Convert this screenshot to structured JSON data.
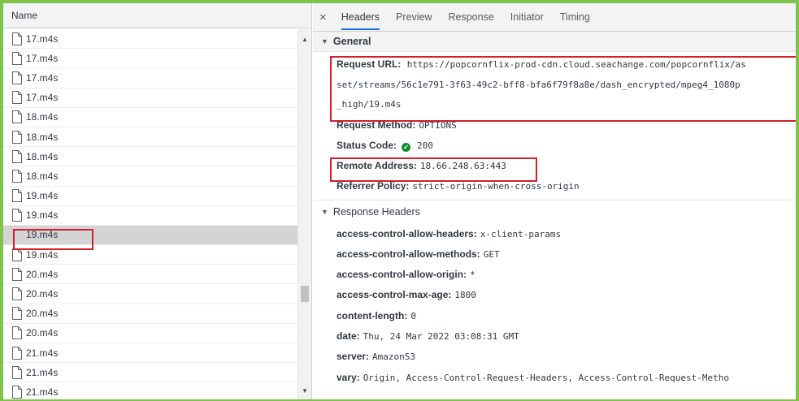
{
  "left_pane": {
    "header": "Name",
    "files": [
      "17.m4s",
      "17.m4s",
      "17.m4s",
      "17.m4s",
      "18.m4s",
      "18.m4s",
      "18.m4s",
      "18.m4s",
      "19.m4s",
      "19.m4s",
      "19.m4s",
      "19.m4s",
      "20.m4s",
      "20.m4s",
      "20.m4s",
      "20.m4s",
      "21.m4s",
      "21.m4s",
      "21.m4s"
    ],
    "selected_index": 10
  },
  "tabs": {
    "close": "×",
    "items": [
      "Headers",
      "Preview",
      "Response",
      "Initiator",
      "Timing"
    ],
    "active": "Headers"
  },
  "general": {
    "title": "General",
    "request_url_label": "Request URL:",
    "request_url_lines": [
      "https://popcornflix-prod-cdn.cloud.seachange.com/popcornflix/as",
      "set/streams/56c1e791-3f63-49c2-bff8-bfa6f79f8a8e/dash_encrypted/mpeg4_1080p",
      "_high/19.m4s"
    ],
    "request_method_label": "Request Method:",
    "request_method": "OPTIONS",
    "status_code_label": "Status Code:",
    "status_code": "200",
    "remote_address_label": "Remote Address:",
    "remote_address": "18.66.248.63:443",
    "referrer_policy_label": "Referrer Policy:",
    "referrer_policy": "strict-origin-when-cross-origin"
  },
  "response_headers": {
    "title": "Response Headers",
    "items": [
      {
        "k": "access-control-allow-headers:",
        "v": "x-client-params"
      },
      {
        "k": "access-control-allow-methods:",
        "v": "GET"
      },
      {
        "k": "access-control-allow-origin:",
        "v": "*"
      },
      {
        "k": "access-control-max-age:",
        "v": "1800"
      },
      {
        "k": "content-length:",
        "v": "0"
      },
      {
        "k": "date:",
        "v": "Thu, 24 Mar 2022 03:08:31 GMT"
      },
      {
        "k": "server:",
        "v": "AmazonS3"
      },
      {
        "k": "vary:",
        "v": "Origin, Access-Control-Request-Headers, Access-Control-Request-Metho"
      }
    ]
  },
  "colors": {
    "highlight_box": "#d21f2b",
    "frame": "#7ec34a",
    "status_ok": "#0a8f2a",
    "active_tab": "#1a73e8"
  }
}
